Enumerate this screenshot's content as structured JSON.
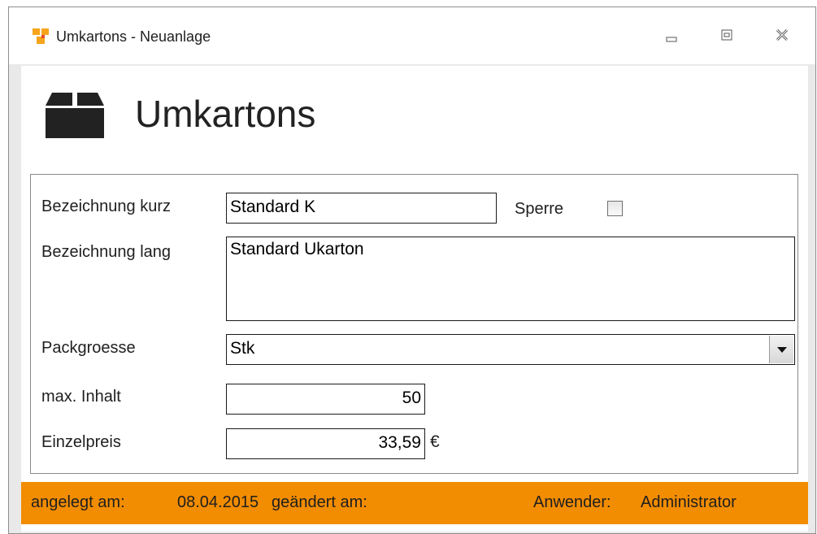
{
  "window": {
    "title": "Umkartons - Neuanlage",
    "minimize_icon": "minimize-icon",
    "restore_icon": "restore-icon",
    "close_icon": "close-icon"
  },
  "header": {
    "title": "Umkartons",
    "icon": "box-icon"
  },
  "form": {
    "bezeichnung_kurz": {
      "label": "Bezeichnung kurz",
      "value": "Standard K"
    },
    "sperre": {
      "label": "Sperre",
      "checked": false
    },
    "bezeichnung_lang": {
      "label": "Bezeichnung lang",
      "value": "Standard Ukarton"
    },
    "packgroesse": {
      "label": "Packgroesse",
      "value": "Stk"
    },
    "max_inhalt": {
      "label": "max. Inhalt",
      "value": "50"
    },
    "einzelpreis": {
      "label": "Einzelpreis",
      "value": "33,59",
      "currency": "€"
    }
  },
  "footer": {
    "angelegt_label": "angelegt am:",
    "angelegt_value": "08.04.2015",
    "geaendert_label": "geändert am:",
    "anwender_label": "Anwender:",
    "anwender_value": "Administrator"
  },
  "colors": {
    "footer_bg": "#f28c00",
    "window_border": "#8e8e8e"
  }
}
